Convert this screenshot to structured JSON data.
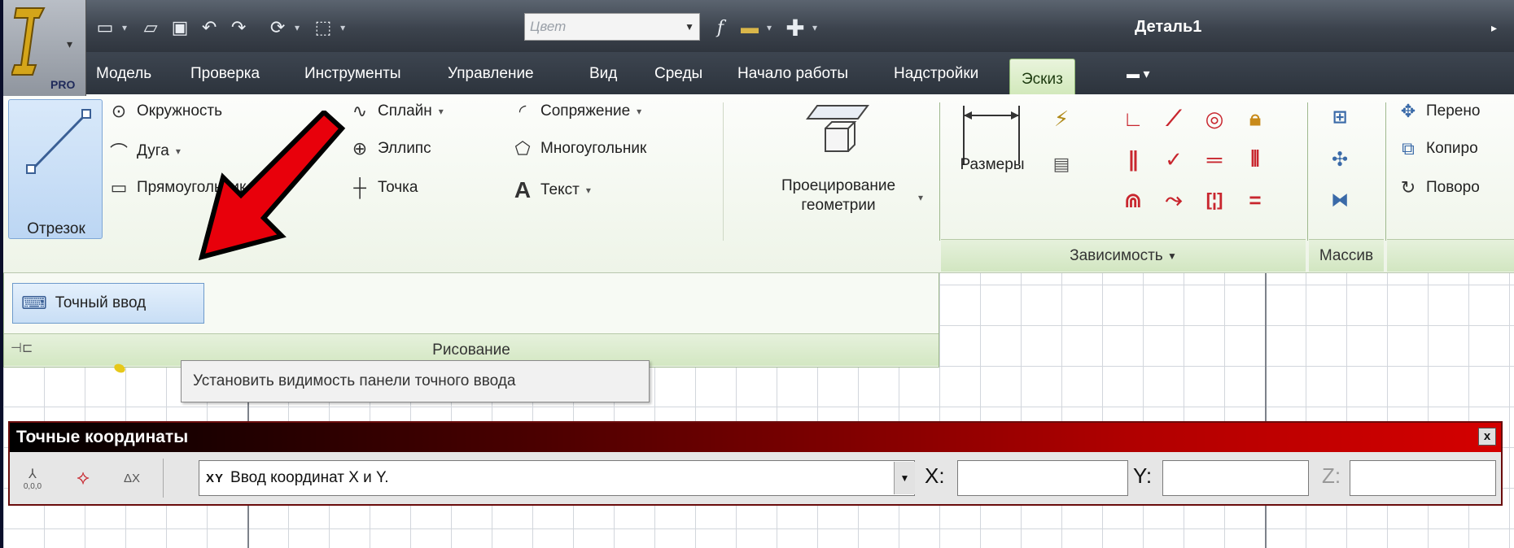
{
  "app": {
    "badge": "PRO",
    "document_title": "Деталь1"
  },
  "qat": {
    "color_placeholder": "Цвет",
    "fx_label": "f"
  },
  "tabs": [
    "Модель",
    "Проверка",
    "Инструменты",
    "Управление",
    "Вид",
    "Среды",
    "Начало работы",
    "Надстройки",
    "Эскиз"
  ],
  "active_tab": "Эскиз",
  "draw_group": {
    "segment": "Отрезок",
    "circle": "Окружность",
    "arc": "Дуга",
    "rectangle": "Прямоугольник",
    "spline": "Сплайн",
    "ellipse": "Эллипс",
    "point": "Точка",
    "fillet": "Сопряжение",
    "polygon": "Многоугольник",
    "text": "Текст",
    "text_glyph": "A",
    "projection_line1": "Проецирование",
    "projection_line2": "геометрии",
    "label": "Рисование",
    "precise_input": "Точный ввод"
  },
  "constraint_group": {
    "dimensions": "Размеры",
    "label": "Зависимость"
  },
  "pattern_group": {
    "label": "Массив"
  },
  "modify_group": {
    "move": "Перено",
    "copy": "Копиро",
    "rotate": "Поворо"
  },
  "tooltip": "Установить видимость панели точного ввода",
  "precise_coords": {
    "title": "Точные координаты",
    "close": "x",
    "mode_prefix": "XY",
    "mode": "Ввод координат X и Y.",
    "x_label": "X:",
    "y_label": "Y:",
    "z_label": "Z:",
    "origin_label": "0,0,0"
  },
  "colors": {
    "accent_red": "#e8000b",
    "ribbon_green": "#d2e6c1",
    "title_bar": "#3c434d"
  }
}
